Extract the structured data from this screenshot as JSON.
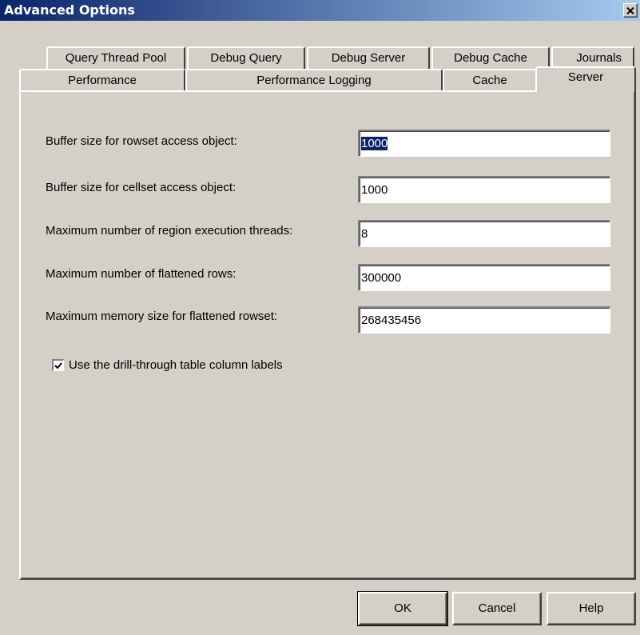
{
  "window": {
    "title": "Advanced Options"
  },
  "tabs": {
    "row1": [
      {
        "label": "Query Thread Pool"
      },
      {
        "label": "Debug Query"
      },
      {
        "label": "Debug Server"
      },
      {
        "label": "Debug Cache"
      },
      {
        "label": "Journals"
      }
    ],
    "row2": [
      {
        "label": "Performance"
      },
      {
        "label": "Performance Logging"
      },
      {
        "label": "Cache"
      },
      {
        "label": "Server",
        "active": true
      }
    ]
  },
  "server": {
    "fields": [
      {
        "label": "Buffer size for rowset access object:",
        "value": "1000"
      },
      {
        "label": "Buffer size for cellset access object:",
        "value": "1000"
      },
      {
        "label": "Maximum number of region execution threads:",
        "value": "8"
      },
      {
        "label": "Maximum number of flattened rows:",
        "value": "300000"
      },
      {
        "label": "Maximum memory size for flattened rowset:",
        "value": "268435456"
      }
    ],
    "checkbox": {
      "label": "Use the drill-through table column labels",
      "checked": true
    }
  },
  "buttons": {
    "ok": "OK",
    "cancel": "Cancel",
    "help": "Help"
  },
  "icons": {
    "close": "close-icon",
    "check": "checkmark-icon"
  }
}
